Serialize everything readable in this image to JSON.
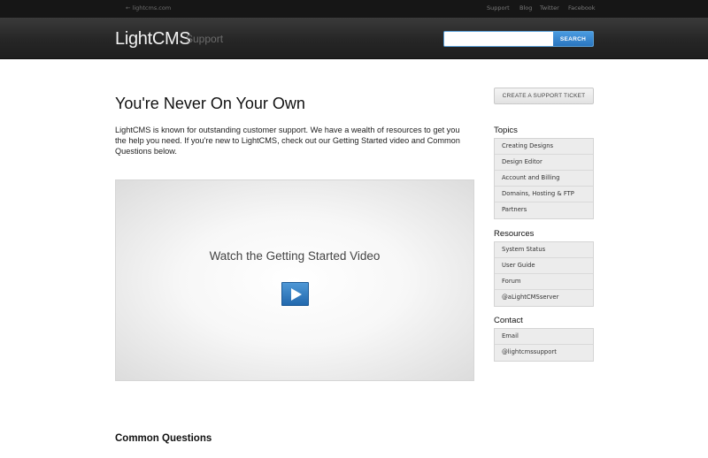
{
  "topbar": {
    "back_link": "← lightcms.com",
    "links": [
      "Support",
      "Blog",
      "Twitter",
      "Facebook"
    ]
  },
  "header": {
    "logo": "LightCMS",
    "logo_sub": "Support",
    "search_placeholder": "",
    "search_button": "SEARCH"
  },
  "main": {
    "title": "You're Never On Your Own",
    "intro": "LightCMS is known for outstanding customer support. We have a wealth of resources to get you the help you need. If you're new to LightCMS, check out our Getting Started video and Common Questions below.",
    "video_title": "Watch the Getting Started Video",
    "common_questions": "Common Questions"
  },
  "sidebar": {
    "ticket_button": "CREATE A SUPPORT TICKET",
    "topics": {
      "heading": "Topics",
      "items": [
        "Creating Designs",
        "Design Editor",
        "Account and Billing",
        "Domains, Hosting & FTP",
        "Partners"
      ]
    },
    "resources": {
      "heading": "Resources",
      "items": [
        "System Status",
        "User Guide",
        "Forum",
        "@aLightCMSserver"
      ]
    },
    "contact": {
      "heading": "Contact",
      "items": [
        "Email",
        "@lightcmssupport"
      ]
    }
  },
  "colors": {
    "accent": "#2a76c0",
    "header_bg": "#262626"
  },
  "icons": {
    "play": "play-icon"
  }
}
